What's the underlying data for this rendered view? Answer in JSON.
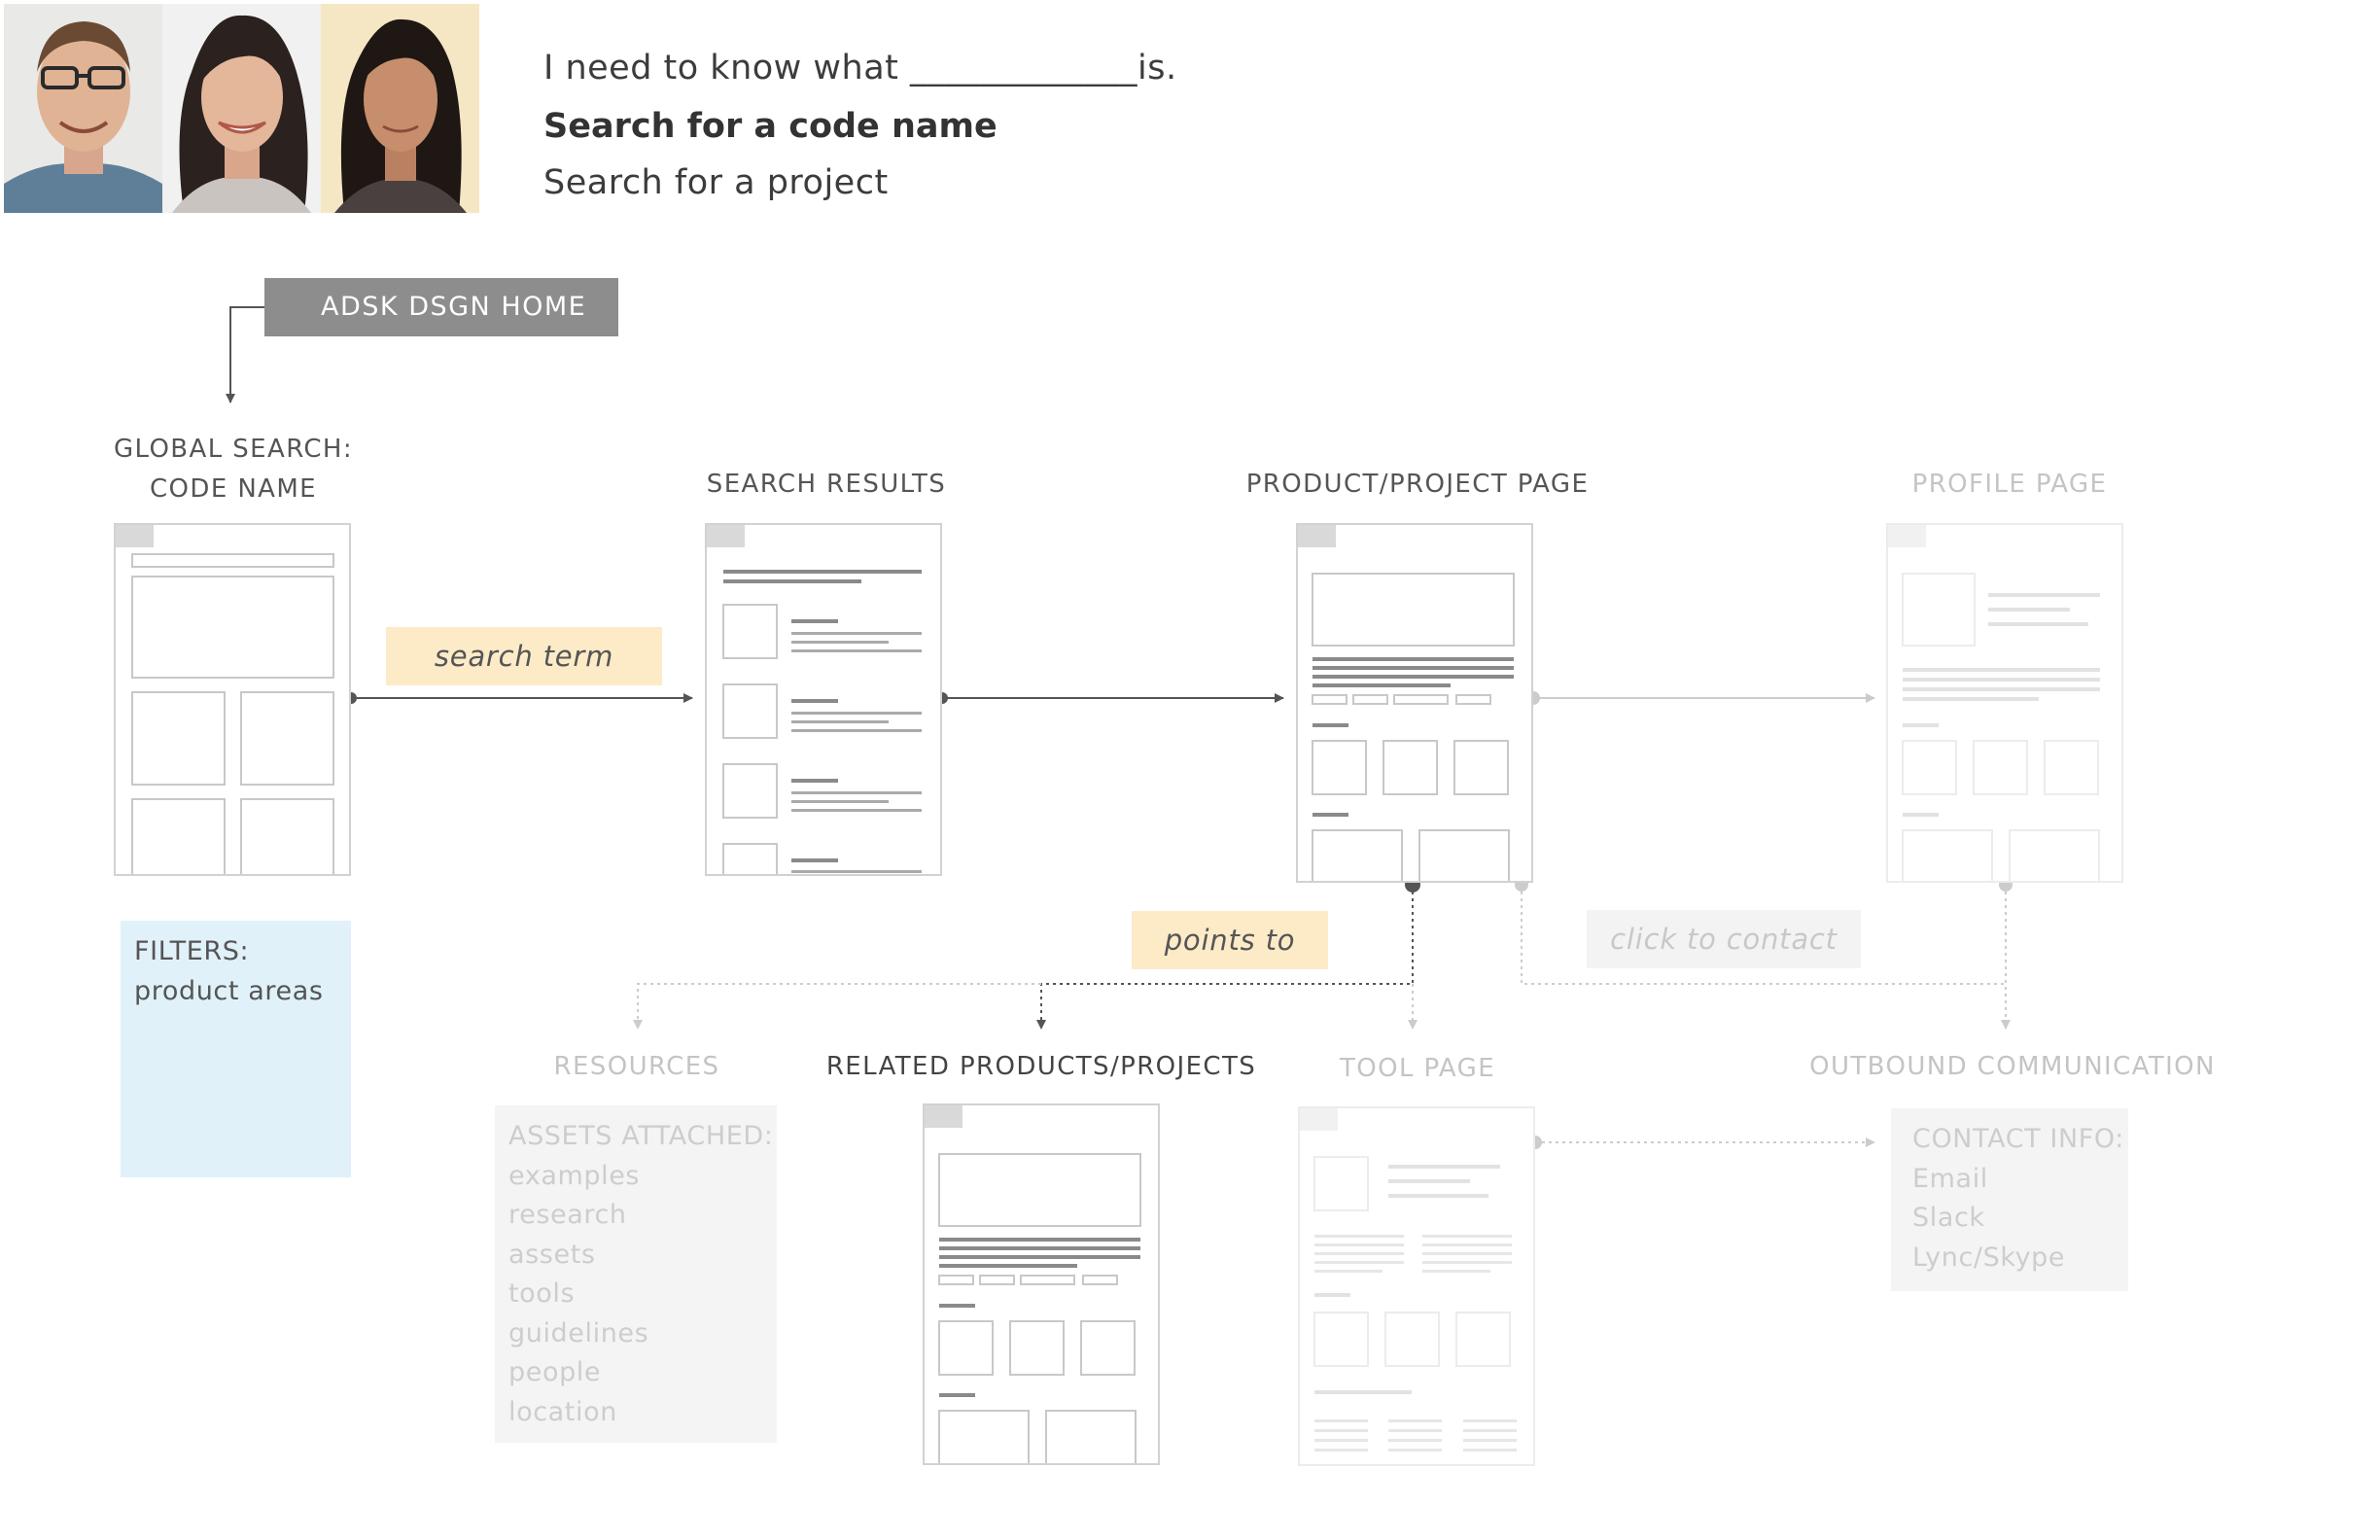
{
  "personas": [
    {
      "name": "persona-1"
    },
    {
      "name": "persona-2"
    },
    {
      "name": "persona-3"
    }
  ],
  "scenario": {
    "line1": "I need to know what _____________is.",
    "line2": "Search for a code name",
    "line3": "Search for a project"
  },
  "entry_point": "ADSK DSGN HOME",
  "steps": {
    "global_search": {
      "line1": "GLOBAL SEARCH:",
      "line2": "CODE NAME"
    },
    "search_results": "SEARCH RESULTS",
    "product_page": "PRODUCT/PROJECT PAGE",
    "profile_page": "PROFILE PAGE",
    "resources": "RESOURCES",
    "related": "RELATED PRODUCTS/PROJECTS",
    "tool_page": "TOOL PAGE",
    "outbound": "OUTBOUND COMMUNICATION"
  },
  "connectors": {
    "search_term": "search term",
    "points_to": "points to",
    "click_to_contact": "click to contact"
  },
  "filters": {
    "heading": "FILTERS:",
    "items": [
      "product areas"
    ]
  },
  "assets": {
    "heading": "ASSETS ATTACHED:",
    "items": [
      "examples",
      "research",
      "assets",
      "tools",
      "guidelines",
      "people",
      "location"
    ]
  },
  "contact": {
    "heading": "CONTACT INFO:",
    "items": [
      "Email",
      "Slack",
      "Lync/Skype"
    ]
  },
  "colors": {
    "tag": "#fdebc8",
    "filters": "#e1f1fa",
    "entry": "#8d8d8d",
    "line_active": "#555555",
    "line_faded": "#cccccc"
  }
}
